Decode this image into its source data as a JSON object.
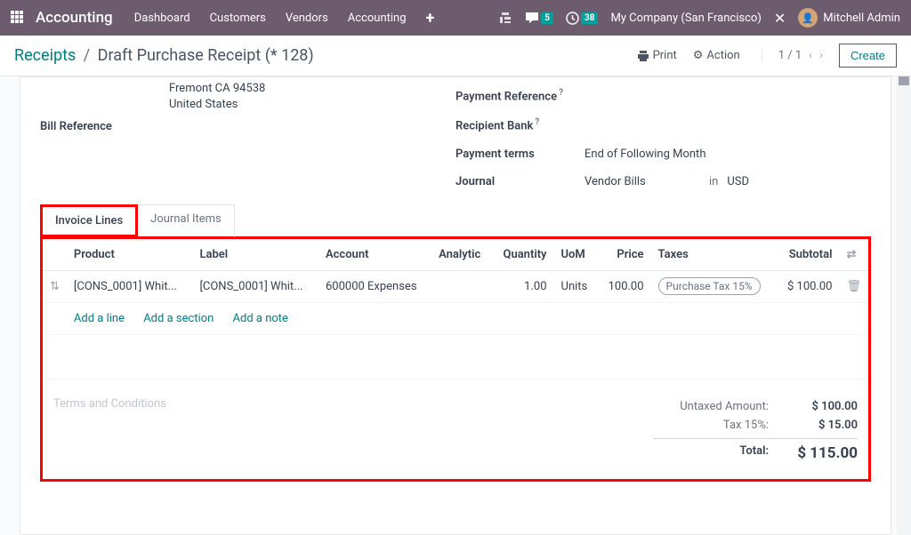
{
  "topnav": {
    "brand": "Accounting",
    "menu": [
      "Dashboard",
      "Customers",
      "Vendors",
      "Accounting"
    ],
    "messages_count": "5",
    "activities_count": "38",
    "company": "My Company (San Francisco)",
    "user": "Mitchell Admin"
  },
  "actionbar": {
    "breadcrumb_root": "Receipts",
    "breadcrumb_current": "Draft Purchase Receipt (* 128)",
    "print": "Print",
    "action": "Action",
    "pager": "1 / 1",
    "create": "Create"
  },
  "form": {
    "left": {
      "address_line1": "Fremont CA 94538",
      "address_line2": "United States",
      "bill_ref_label": "Bill Reference"
    },
    "right": {
      "payment_ref_label": "Payment Reference",
      "recipient_bank_label": "Recipient Bank",
      "payment_terms_label": "Payment terms",
      "payment_terms_value": "End of Following Month",
      "journal_label": "Journal",
      "journal_value": "Vendor Bills",
      "journal_in": "in",
      "journal_currency": "USD"
    }
  },
  "tabs": {
    "invoice_lines": "Invoice Lines",
    "journal_items": "Journal Items"
  },
  "table": {
    "headers": {
      "product": "Product",
      "label": "Label",
      "account": "Account",
      "analytic": "Analytic",
      "quantity": "Quantity",
      "uom": "UoM",
      "price": "Price",
      "taxes": "Taxes",
      "subtotal": "Subtotal"
    },
    "rows": [
      {
        "product": "[CONS_0001] Whit...",
        "label": "[CONS_0001] Whit...",
        "account": "600000 Expenses",
        "analytic": "",
        "quantity": "1.00",
        "uom": "Units",
        "price": "100.00",
        "taxes": "Purchase Tax 15%",
        "subtotal": "$ 100.00"
      }
    ],
    "add_line": "Add a line",
    "add_section": "Add a section",
    "add_note": "Add a note"
  },
  "terms_placeholder": "Terms and Conditions",
  "totals": {
    "untaxed_label": "Untaxed Amount:",
    "untaxed_value": "$ 100.00",
    "tax_label": "Tax 15%:",
    "tax_value": "$ 15.00",
    "total_label": "Total:",
    "total_value": "$ 115.00"
  }
}
